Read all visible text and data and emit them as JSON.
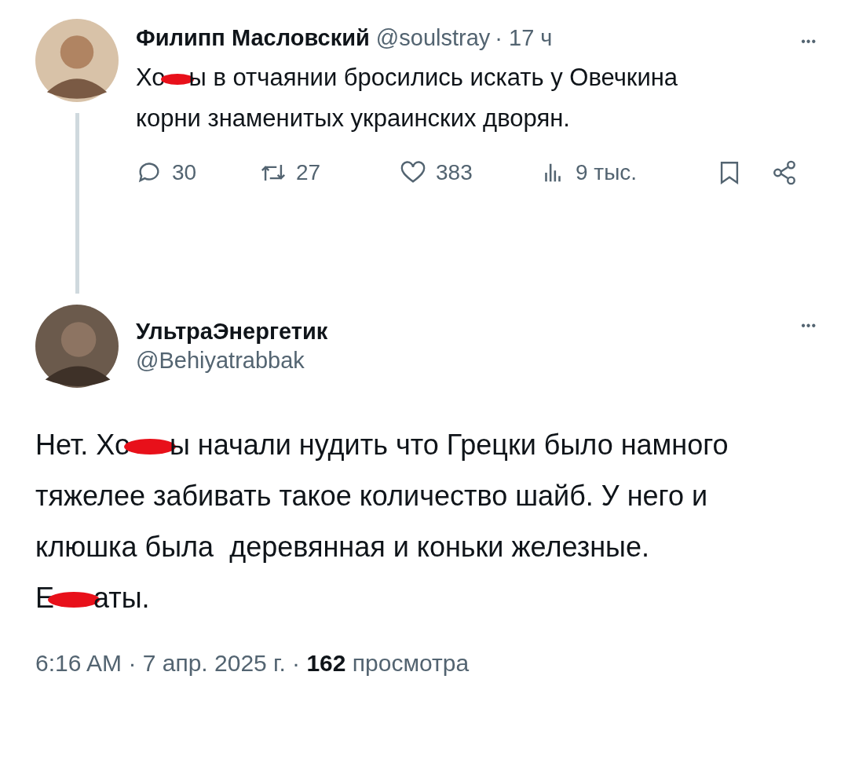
{
  "posts": [
    {
      "kind": "reply_parent",
      "author": {
        "name": "Филипп Масловский",
        "handle": "@soulstray",
        "time": "· 17 ч"
      },
      "more": "•••",
      "body": [
        {
          "kind": "text",
          "text": "Хо"
        },
        {
          "kind": "redaction"
        },
        {
          "kind": "text",
          "text": "ы в отчаянии бросились искать у Овечкина корни знаменитых украинских дворян."
        }
      ],
      "actions": [
        {
          "kind": "reply",
          "count": "30"
        },
        {
          "kind": "repost",
          "count": "27"
        },
        {
          "kind": "like",
          "count": "383"
        },
        {
          "kind": "views",
          "count": "9 тыс."
        },
        {
          "kind": "bookmark"
        },
        {
          "kind": "share"
        }
      ]
    },
    {
      "kind": "main",
      "author": {
        "name": "УльтраЭнергетик",
        "handle": "@Behiyatrabbak"
      },
      "more": "•••",
      "body": [
        {
          "kind": "text",
          "text": "Нет. Хо"
        },
        {
          "kind": "redaction"
        },
        {
          "kind": "text",
          "text": "ы начали нудить что Грецки было намного тяжелее забивать такое количество шайб. У него и клюшка была  деревянная и коньки железные.\nЕ"
        },
        {
          "kind": "redaction"
        },
        {
          "kind": "text",
          "text": "аты."
        }
      ],
      "footer": "6:16 AM · 7 апр. 2025 г. · **162** просмотра"
    }
  ]
}
